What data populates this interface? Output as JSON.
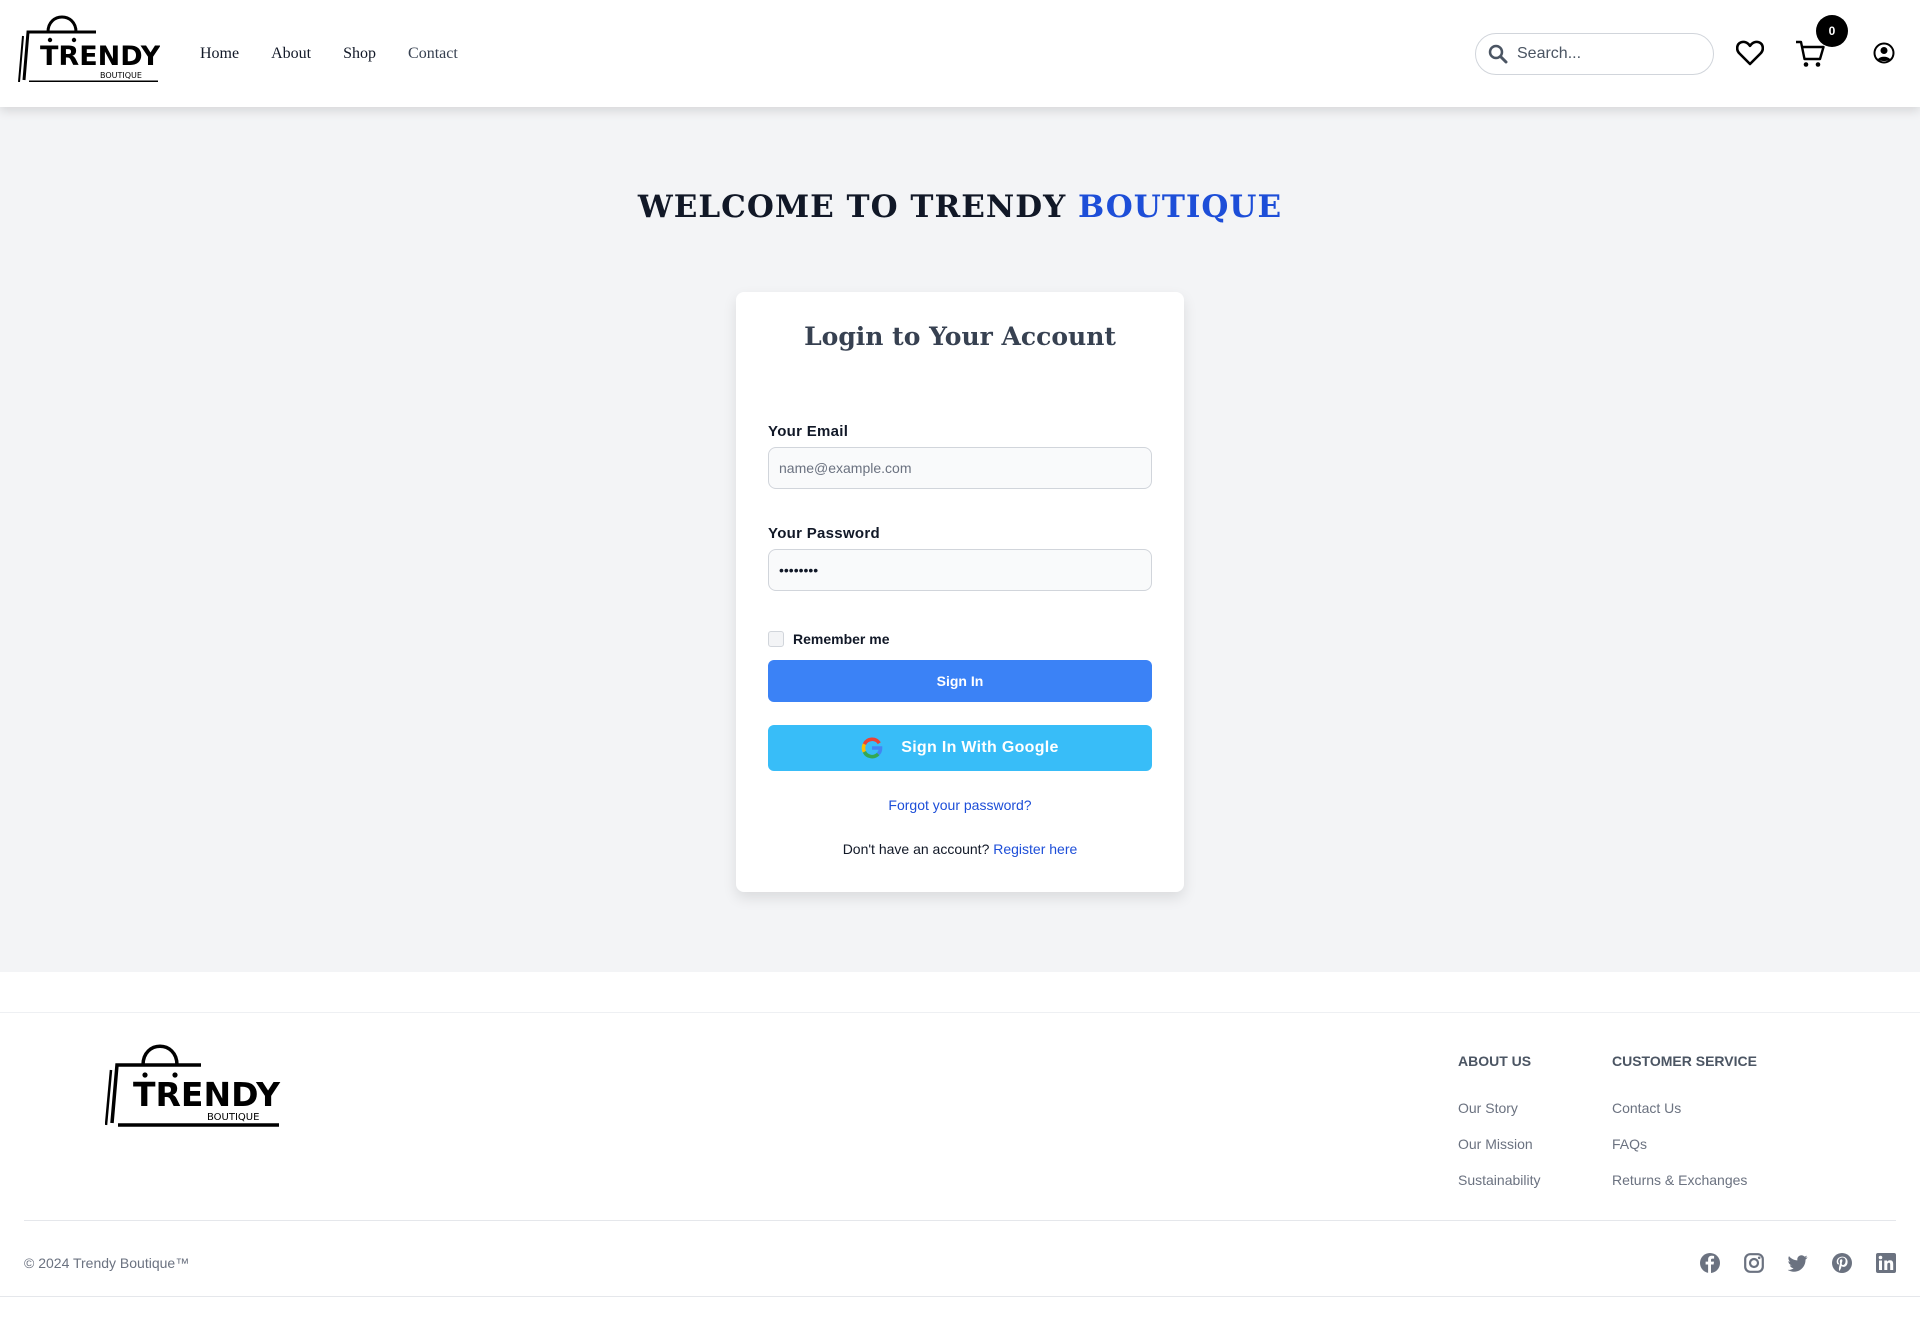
{
  "brand": {
    "name": "TRENDY",
    "sub": "BOUTIQUE"
  },
  "nav": {
    "home": "Home",
    "about": "About",
    "shop": "Shop",
    "contact": "Contact"
  },
  "search": {
    "placeholder": "Search..."
  },
  "cart": {
    "count": "0"
  },
  "main": {
    "welcome_prefix": "WELCOME TO TRENDY ",
    "welcome_accent": "BOUTIQUE",
    "accent_color": "#1d4ed8"
  },
  "login": {
    "title": "Login to Your Account",
    "email_label": "Your Email",
    "email_placeholder": "name@example.com",
    "password_label": "Your Password",
    "password_value": "••••••••",
    "remember_label": "Remember me",
    "signin_label": "Sign In",
    "signin_color": "#3b82f6",
    "google_label": "Sign In With Google",
    "google_color": "#38bdf8",
    "forgot_label": "Forgot your password?",
    "register_prompt": "Don't have an account?",
    "register_link": "Register here"
  },
  "footer": {
    "about": {
      "heading": "ABOUT US",
      "links": [
        "Our Story",
        "Our Mission",
        "Sustainability"
      ]
    },
    "service": {
      "heading": "CUSTOMER SERVICE",
      "links": [
        "Contact Us",
        "FAQs",
        "Returns & Exchanges"
      ]
    },
    "copyright": "© 2024 Trendy Boutique™",
    "social_icons": [
      "facebook-icon",
      "instagram-icon",
      "twitter-icon",
      "pinterest-icon",
      "linkedin-icon"
    ]
  }
}
